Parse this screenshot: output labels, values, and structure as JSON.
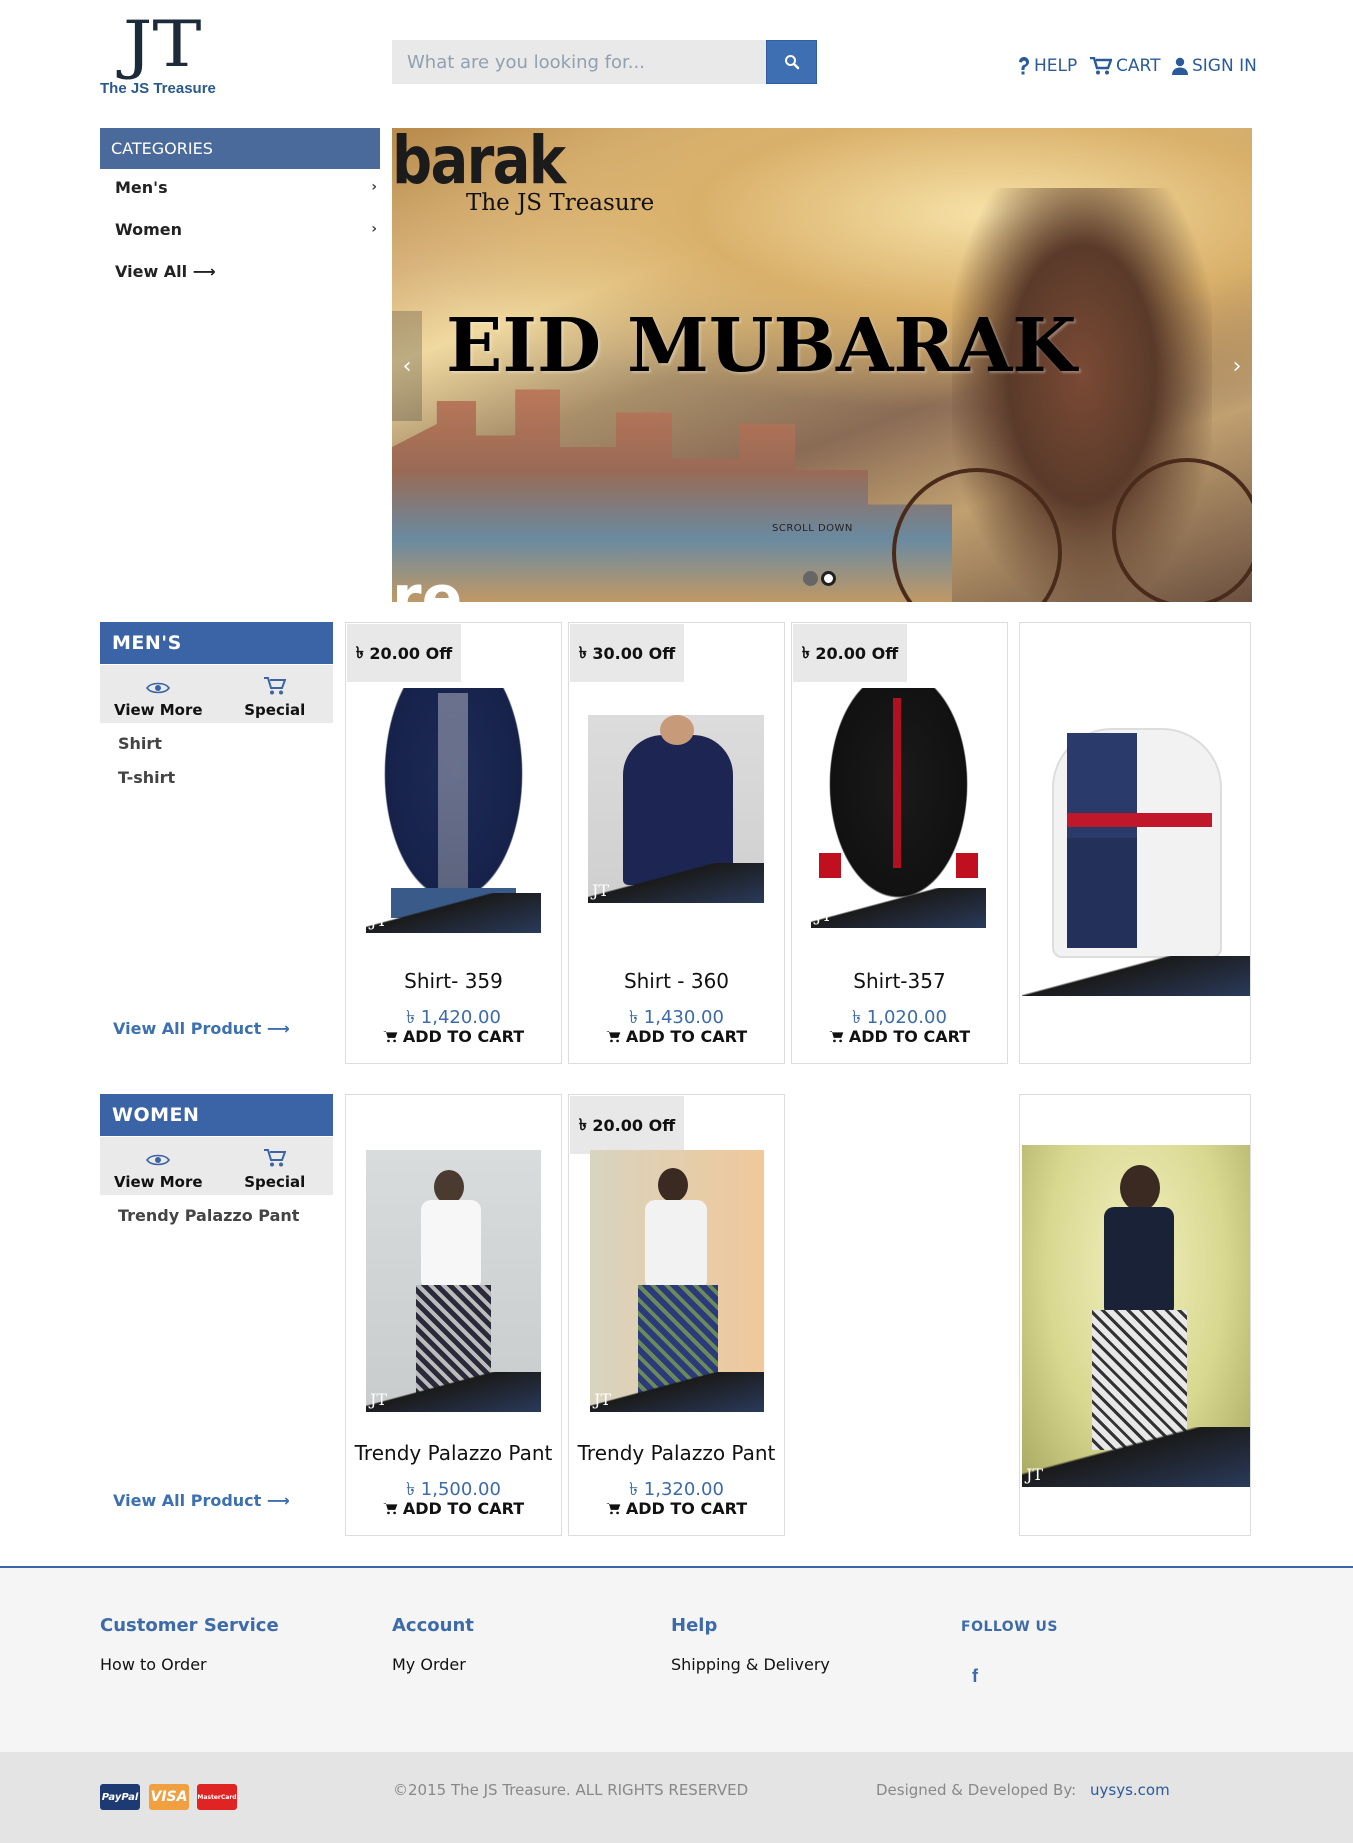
{
  "brand": {
    "name": "The JS Treasure",
    "symbol": "JT"
  },
  "search": {
    "placeholder": "What are you looking for..."
  },
  "topnav": {
    "help": "HELP",
    "cart": "CART",
    "signin": "SIGN IN"
  },
  "categories": {
    "title": "CATEGORIES",
    "items": [
      {
        "label": "Men's",
        "chevron": "›"
      },
      {
        "label": "Women",
        "chevron": "›"
      },
      {
        "label": "View All ⟶"
      }
    ]
  },
  "banner": {
    "top_text": "barak",
    "brand": "The JS Treasure",
    "title": "EID MUBARAK",
    "scroll_hint": "SCROLL  DOWN",
    "bottom_text": "re",
    "prev": "‹",
    "next": "›",
    "slides": 2,
    "active_slide": 2
  },
  "sections": [
    {
      "title": "MEN'S",
      "tools": {
        "view_more": "View More",
        "special": "Special"
      },
      "subs": [
        "Shirt",
        "T-shirt"
      ],
      "view_all": "View All Product ⟶",
      "products": [
        {
          "off": "20.00 Off",
          "name": "Shirt- 359",
          "price": "1,420.00",
          "cart": "ADD TO CART"
        },
        {
          "off": "30.00 Off",
          "name": "Shirt - 360",
          "price": "1,430.00",
          "cart": "ADD TO CART"
        },
        {
          "off": "20.00 Off",
          "name": "Shirt-357",
          "price": "1,020.00",
          "cart": "ADD TO CART"
        }
      ]
    },
    {
      "title": "WOMEN",
      "tools": {
        "view_more": "View More",
        "special": "Special"
      },
      "subs": [
        "Trendy Palazzo Pant"
      ],
      "view_all": "View All Product ⟶",
      "products": [
        {
          "name": "Trendy Palazzo Pant",
          "price": "1,500.00",
          "cart": "ADD TO CART"
        },
        {
          "off": "20.00 Off",
          "name": "Trendy Palazzo Pant",
          "price": "1,320.00",
          "cart": "ADD TO CART"
        }
      ]
    }
  ],
  "currency_symbol": "৳",
  "footer": {
    "columns": [
      {
        "title": "Customer Service",
        "links": [
          "How to Order"
        ]
      },
      {
        "title": "Account",
        "links": [
          "My Order"
        ]
      },
      {
        "title": "Help",
        "links": [
          "Shipping & Delivery"
        ]
      },
      {
        "title": "FOLLOW US",
        "links": [
          "f"
        ]
      }
    ],
    "payments": [
      "PayPal",
      "VISA",
      "MasterCard"
    ],
    "copyright": "©2015 The JS Treasure. ALL RIGHTS RESERVED",
    "designed_by": "Designed & Developed By:",
    "designer": "uysys.com"
  },
  "colors": {
    "primary": "#3b64a6",
    "link": "#3d6ba8"
  }
}
